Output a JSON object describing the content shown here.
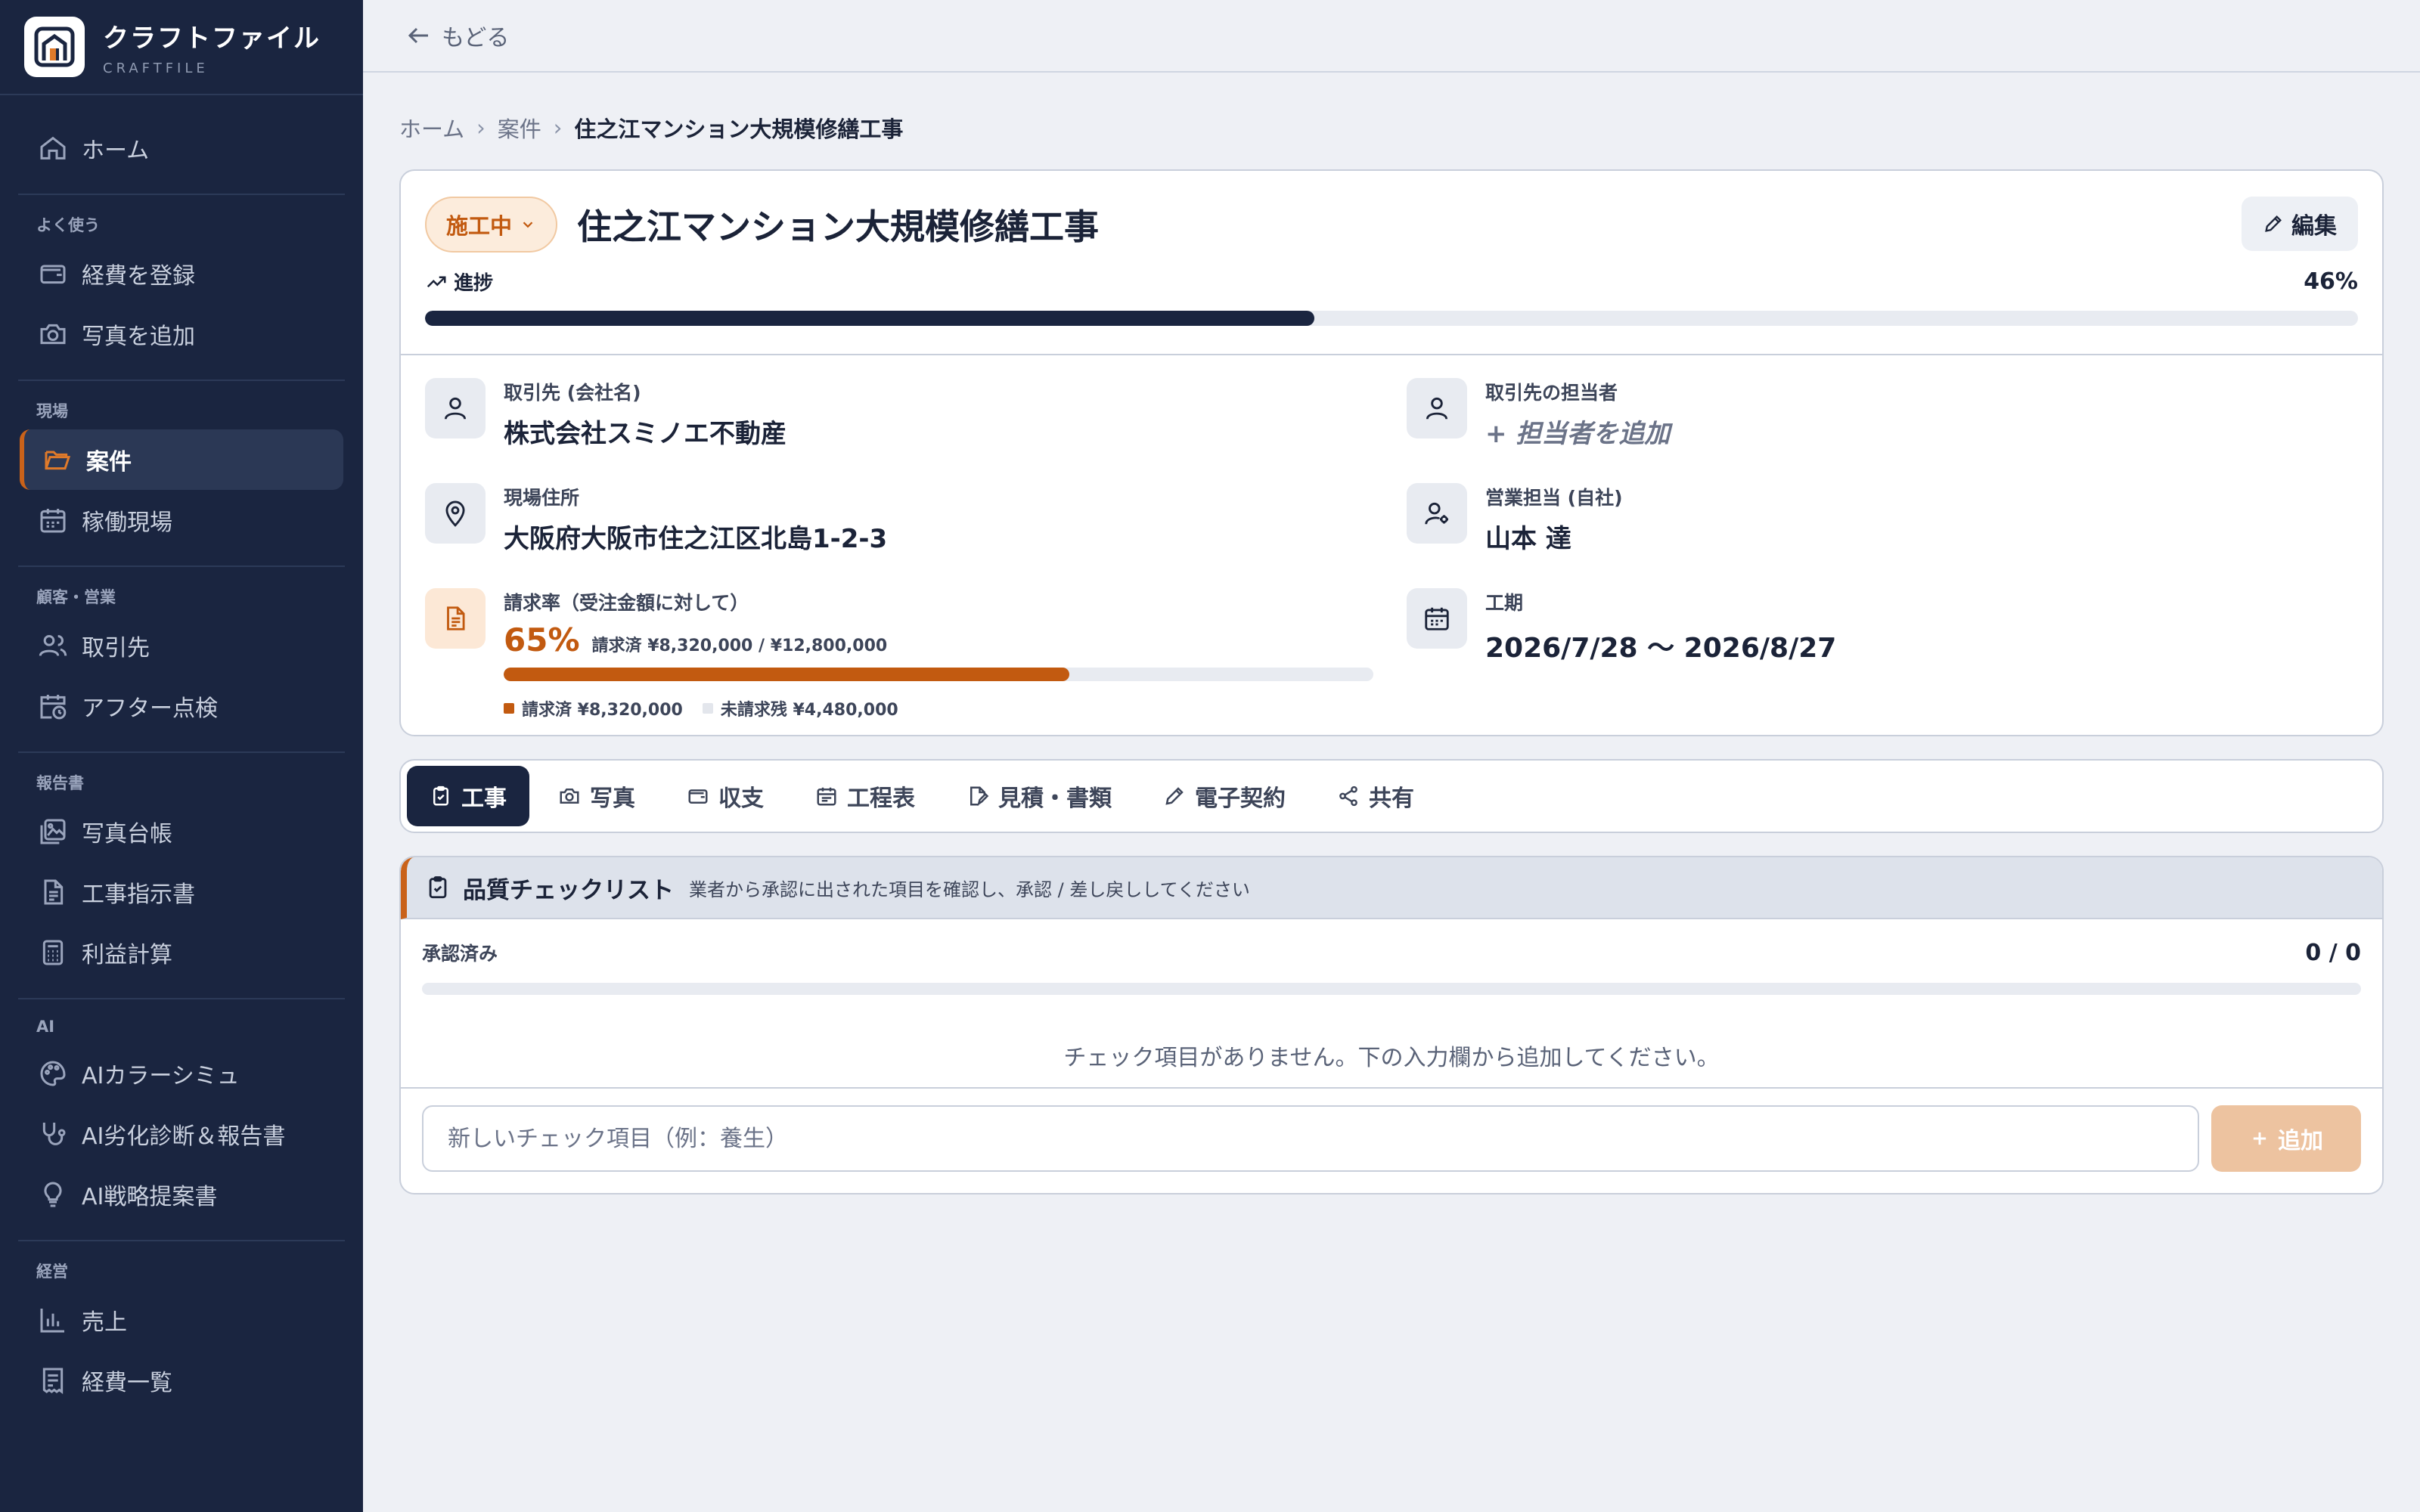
{
  "brand": {
    "name": "クラフトファイル",
    "sub": "CRAFTFILE"
  },
  "nav": {
    "home": "ホーム",
    "sections": {
      "frequent": "よく使う",
      "site": "現場",
      "clients": "顧客・営業",
      "reports": "報告書",
      "ai": "AI",
      "management": "経営"
    },
    "expense_register": "経費を登録",
    "add_photo": "写真を追加",
    "projects": "案件",
    "active_sites": "稼働現場",
    "clients": "取引先",
    "after_check": "アフター点検",
    "photo_ledger": "写真台帳",
    "work_order": "工事指示書",
    "profit_calc": "利益計算",
    "ai_color": "AIカラーシミュ",
    "ai_diagnosis": "AI劣化診断＆報告書",
    "ai_strategy": "AI戦略提案書",
    "sales": "売上",
    "expense_list": "経費一覧"
  },
  "topbar": {
    "back": "もどる"
  },
  "breadcrumb": {
    "home": "ホーム",
    "projects": "案件",
    "current": "住之江マンション大規模修繕工事"
  },
  "project": {
    "status": "施工中",
    "title": "住之江マンション大規模修繕工事",
    "edit": "編集",
    "progress_label": "進捗",
    "progress_text": "46%",
    "progress": 0.46
  },
  "info": {
    "client_label": "取引先 (会社名)",
    "client": "株式会社スミノエ不動産",
    "client_contact_label": "取引先の担当者",
    "client_contact": "+ 担当者を追加",
    "address_label": "現場住所",
    "address": "大阪府大阪市住之江区北島1-2-3",
    "sales_rep_label": "営業担当 (自社)",
    "sales_rep": "山本 達",
    "billing_label": "請求率（受注金額に対して）",
    "billing_pct": "65%",
    "billing_amount": "請求済 ¥8,320,000 / ¥12,800,000",
    "billing_ratio": 0.65,
    "billed_legend": "請求済 ¥8,320,000",
    "unbilled_legend": "未請求残 ¥4,480,000",
    "period_label": "工期",
    "period": "2026/7/28 〜 2026/8/27"
  },
  "tabs": [
    "工事",
    "写真",
    "収支",
    "工程表",
    "見積・書類",
    "電子契約",
    "共有"
  ],
  "checklist": {
    "title": "品質チェックリスト",
    "description": "業者から承認に出された項目を確認し、承認 / 差し戻ししてください",
    "approved_label": "承認済み",
    "approved_count": "0 / 0",
    "approved_ratio": 0,
    "empty": "チェック項目がありません。下の入力欄から追加してください。",
    "input_placeholder": "新しいチェック項目（例：養生）",
    "add_button": "追加"
  },
  "colors": {
    "navy": "#1a2540",
    "accent": "#c25a10",
    "bg": "#eef0f5"
  }
}
